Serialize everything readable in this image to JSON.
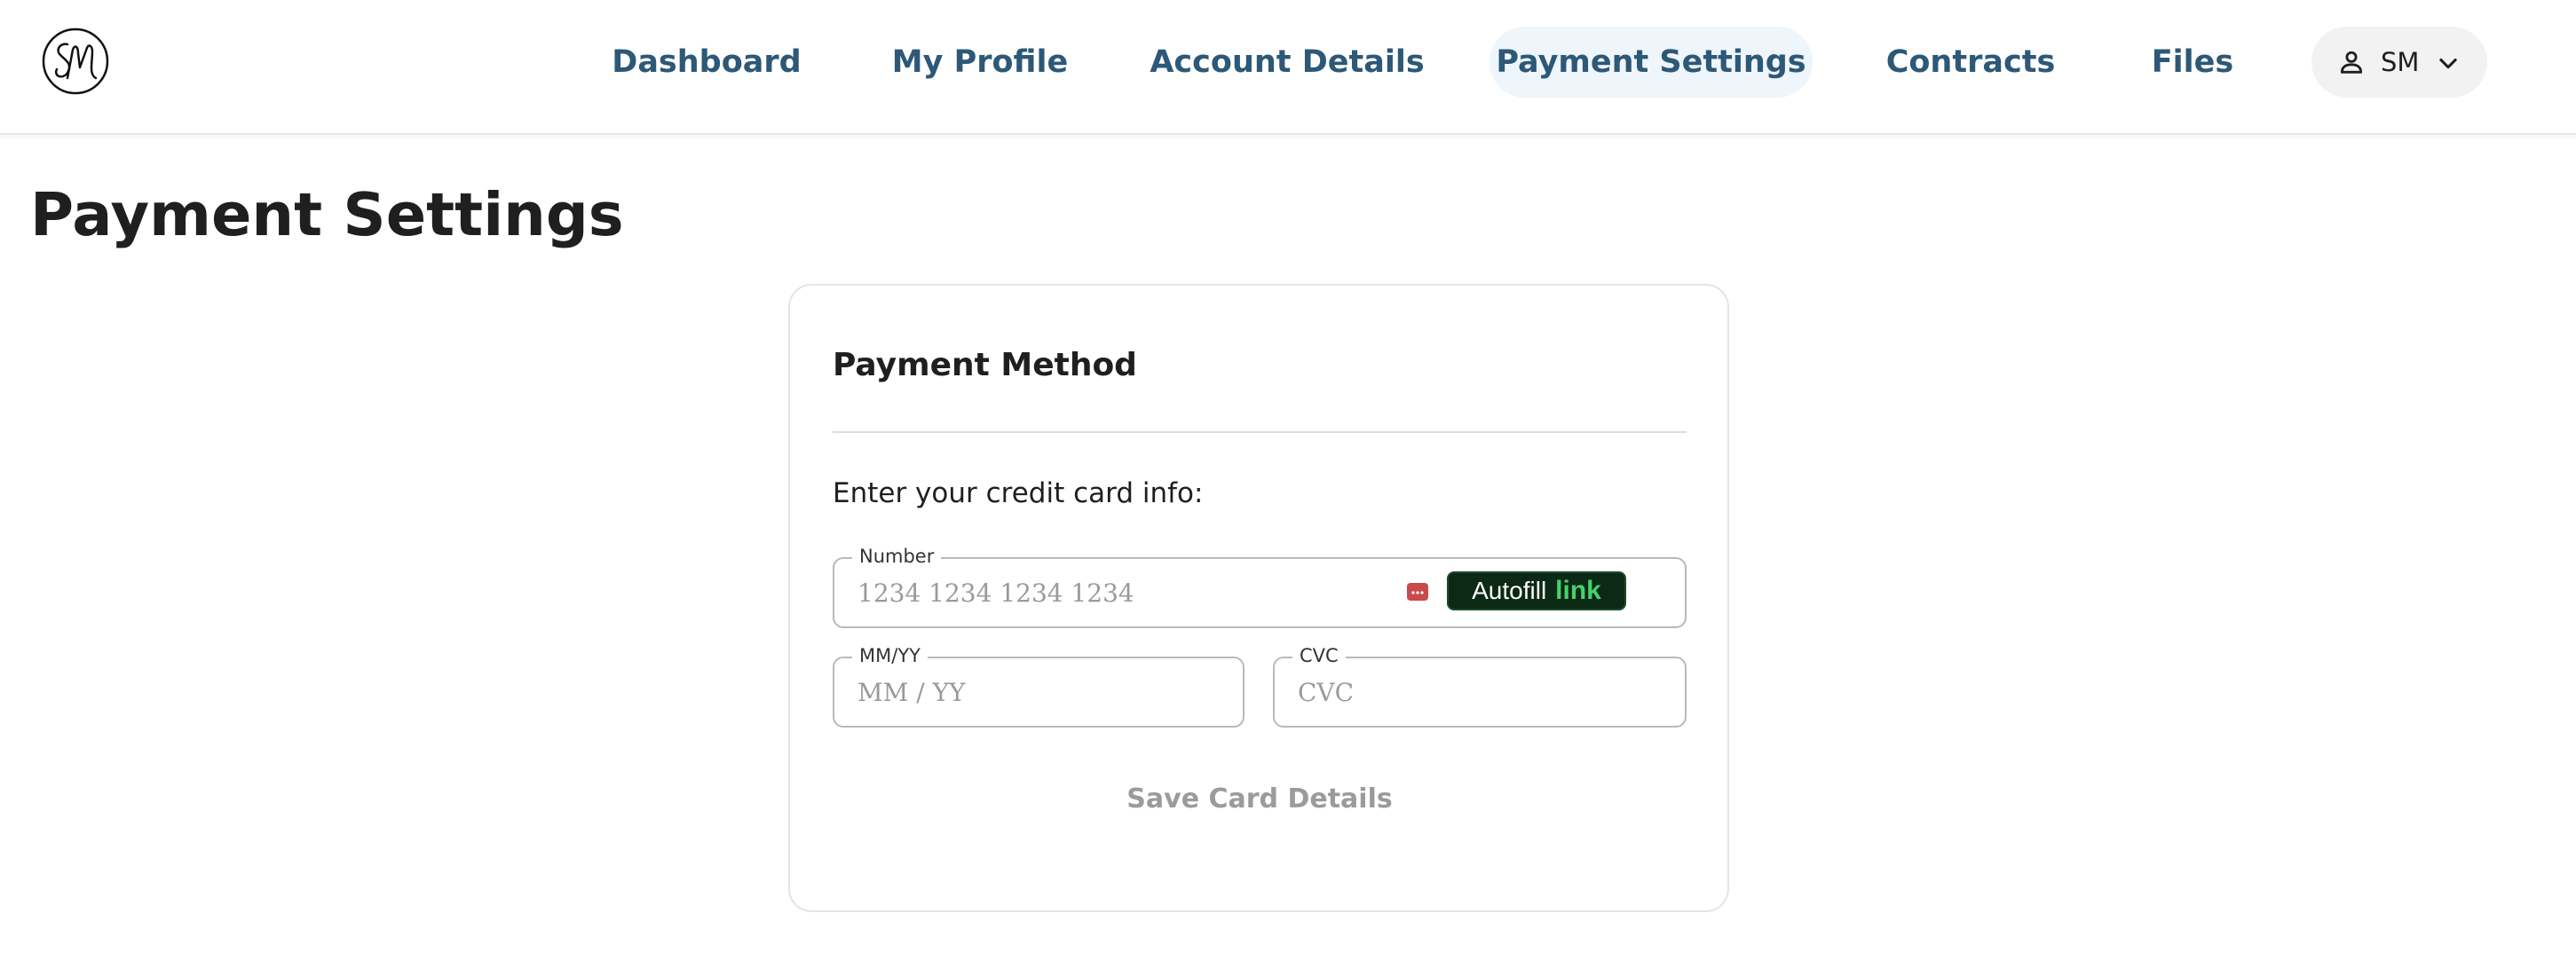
{
  "header": {
    "logo_icon": "sm-monogram-logo",
    "nav": [
      {
        "label": "Dashboard"
      },
      {
        "label": "My Profile"
      },
      {
        "label": "Account Details"
      },
      {
        "label": "Payment Settings",
        "active": true
      },
      {
        "label": "Contracts"
      },
      {
        "label": "Files"
      }
    ],
    "user": {
      "initials": "SM",
      "icon": "person-icon",
      "dropdown_icon": "chevron-down-icon"
    }
  },
  "page": {
    "title": "Payment Settings"
  },
  "payment_card": {
    "heading": "Payment Method",
    "instructions": "Enter your credit card info:",
    "number_field": {
      "label": "Number",
      "placeholder": "1234 1234 1234 1234",
      "value": ""
    },
    "card_brand_icon": "credit-card-icon",
    "autofill": {
      "label": "Autofill",
      "brand": "link"
    },
    "expiry_field": {
      "label": "MM/YY",
      "placeholder": "MM / YY",
      "value": ""
    },
    "cvc_field": {
      "label": "CVC",
      "placeholder": "CVC",
      "value": ""
    },
    "save_button": {
      "label": "Save Card Details",
      "enabled": false
    }
  },
  "colors": {
    "nav_text": "#2d5877",
    "nav_active_bg": "#eef5fb",
    "autofill_bg": "#0c2915",
    "link_green": "#47d16c",
    "disabled_text": "#9b9b9b"
  }
}
